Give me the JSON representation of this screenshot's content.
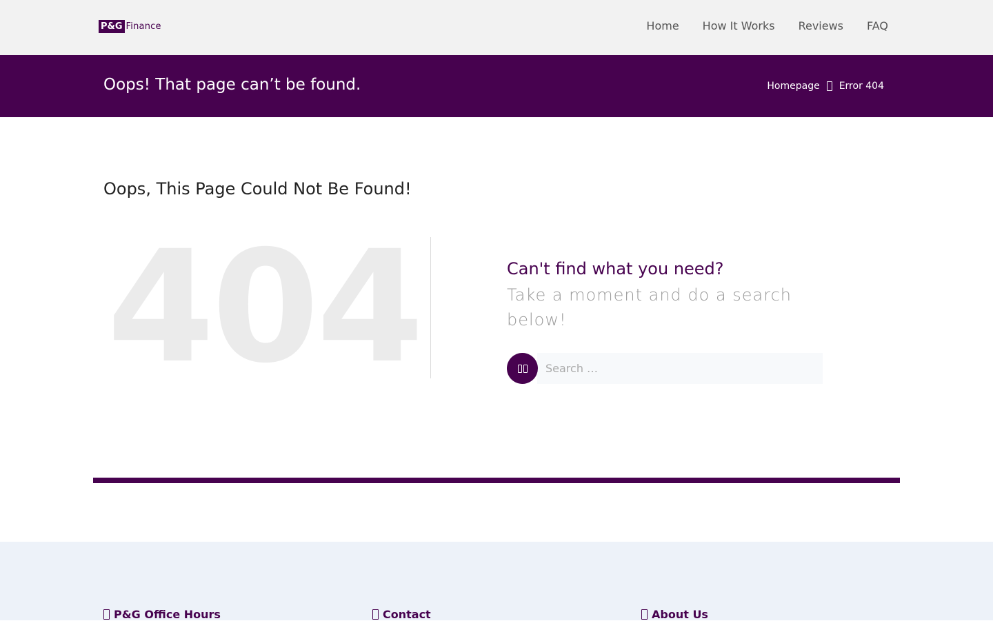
{
  "header": {
    "logo_mark": "P&G",
    "logo_text": "Finance",
    "nav": [
      "Home",
      "How It Works",
      "Reviews",
      "FAQ"
    ]
  },
  "band": {
    "title": "Oops! That page can’t be found.",
    "breadcrumb": [
      "Homepage",
      "Error 404"
    ]
  },
  "main": {
    "heading": "Oops, This Page Could Not Be Found!",
    "big_code": "404",
    "cant_find": "Can't find what you need?",
    "take_moment": "Take a moment and do a search below!",
    "search_placeholder": "Search …"
  },
  "footer": {
    "columns": [
      "P&G Office Hours",
      "Contact",
      "About Us"
    ]
  },
  "colors": {
    "brand": "#47024f",
    "footer_bg": "#edf2f9",
    "header_bg": "#f2f2f2"
  },
  "icons": [
    "search-icon",
    "chevron-right-icon",
    "clock-icon",
    "contact-icon",
    "info-icon"
  ]
}
